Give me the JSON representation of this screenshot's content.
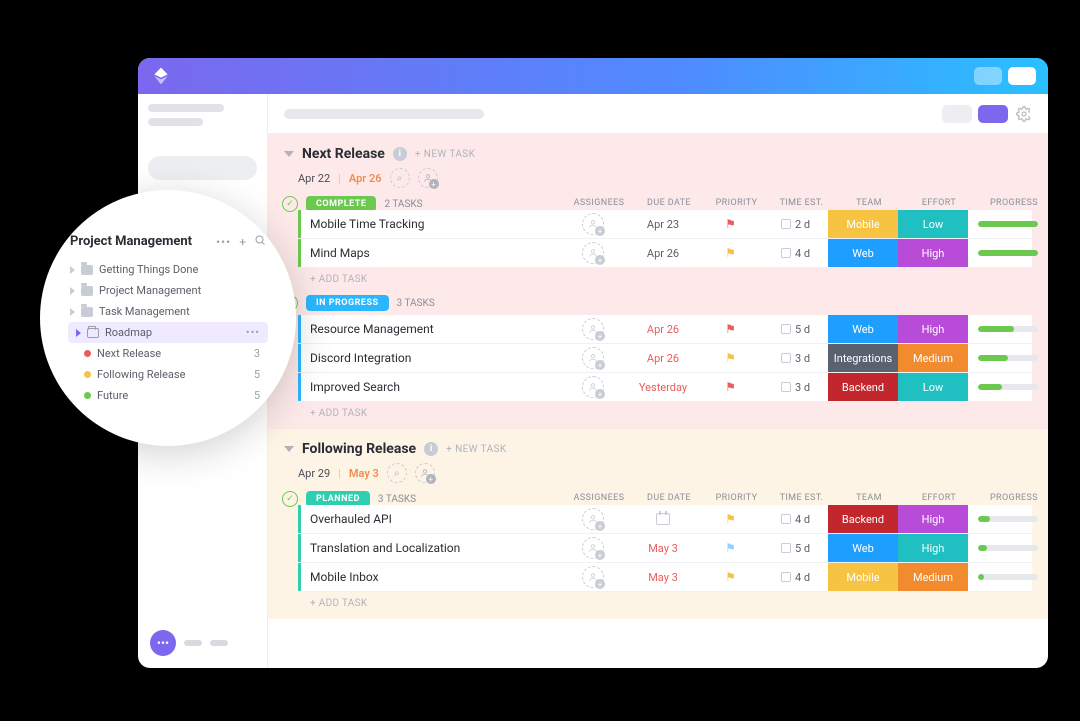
{
  "popover": {
    "title": "Project Management",
    "items": [
      {
        "label": "Getting Things Done",
        "type": "folder"
      },
      {
        "label": "Project Management",
        "type": "folder"
      },
      {
        "label": "Task Management",
        "type": "folder"
      },
      {
        "label": "Roadmap",
        "type": "folder-outline",
        "active": true
      },
      {
        "label": "Next Release",
        "type": "dot",
        "color": "#e85d5d",
        "count": "3"
      },
      {
        "label": "Following Release",
        "type": "dot",
        "color": "#f6c343",
        "count": "5"
      },
      {
        "label": "Future",
        "type": "dot",
        "color": "#6bc950",
        "count": "5"
      }
    ]
  },
  "columns": {
    "assignees": "ASSIGNEES",
    "due": "DUE DATE",
    "priority": "PRIORITY",
    "est": "TIME EST.",
    "team": "TEAM",
    "effort": "EFFORT",
    "progress": "PROGRESS"
  },
  "new_task": "+ NEW TASK",
  "add_task": "+ ADD TASK",
  "sections": [
    {
      "title": "Next Release",
      "date_from": "Apr 22",
      "date_to": "Apr 26",
      "tone": "peach",
      "groups": [
        {
          "status": "COMPLETE",
          "chip": "complete",
          "count": "2 TASKS",
          "bar": "bar-green",
          "tasks": [
            {
              "name": "Mobile Time Tracking",
              "due": "Apr 23",
              "due_red": false,
              "flag": "#e85d5d",
              "est": "2 d",
              "team": "Mobile",
              "team_bg": "#f6c343",
              "effort": "Low",
              "effort_bg": "#1fbfc2",
              "progress": 100
            },
            {
              "name": "Mind Maps",
              "due": "Apr 26",
              "due_red": false,
              "flag": "#f6c343",
              "est": "4 d",
              "team": "Web",
              "team_bg": "#1e9fff",
              "effort": "High",
              "effort_bg": "#b84bd8",
              "progress": 100
            }
          ]
        },
        {
          "status": "IN PROGRESS",
          "chip": "inprog",
          "count": "3 TASKS",
          "bar": "bar-blue",
          "tasks": [
            {
              "name": "Resource Management",
              "due": "Apr 26",
              "due_red": true,
              "flag": "#e85d5d",
              "est": "5 d",
              "team": "Web",
              "team_bg": "#1e9fff",
              "effort": "High",
              "effort_bg": "#b84bd8",
              "progress": 60
            },
            {
              "name": "Discord Integration",
              "due": "Apr 26",
              "due_red": true,
              "flag": "#f6c343",
              "est": "3 d",
              "team": "Integrations",
              "team_bg": "#5a6270",
              "effort": "Medium",
              "effort_bg": "#f28b2e",
              "progress": 50
            },
            {
              "name": "Improved Search",
              "due": "Yesterday",
              "due_red": true,
              "flag": "#e85d5d",
              "est": "3 d",
              "team": "Backend",
              "team_bg": "#c1272d",
              "effort": "Low",
              "effort_bg": "#1fbfc2",
              "progress": 40
            }
          ]
        }
      ]
    },
    {
      "title": "Following Release",
      "date_from": "Apr 29",
      "date_to": "May 3",
      "tone": "cream",
      "groups": [
        {
          "status": "PLANNED",
          "chip": "planned",
          "count": "3 TASKS",
          "bar": "bar-teal",
          "tasks": [
            {
              "name": "Overhauled API",
              "due": "",
              "due_red": false,
              "flag": "#f6c343",
              "est": "4 d",
              "team": "Backend",
              "team_bg": "#c1272d",
              "effort": "High",
              "effort_bg": "#b84bd8",
              "progress": 20
            },
            {
              "name": "Translation and Localization",
              "due": "May 3",
              "due_red": true,
              "flag": "#8fd4ff",
              "est": "5 d",
              "team": "Web",
              "team_bg": "#1e9fff",
              "effort": "High",
              "effort_bg": "#1fbfc2",
              "progress": 15
            },
            {
              "name": "Mobile Inbox",
              "due": "May 3",
              "due_red": true,
              "flag": "#f6c343",
              "est": "4 d",
              "team": "Mobile",
              "team_bg": "#f6c343",
              "effort": "Medium",
              "effort_bg": "#f28b2e",
              "progress": 10
            }
          ]
        }
      ]
    }
  ]
}
